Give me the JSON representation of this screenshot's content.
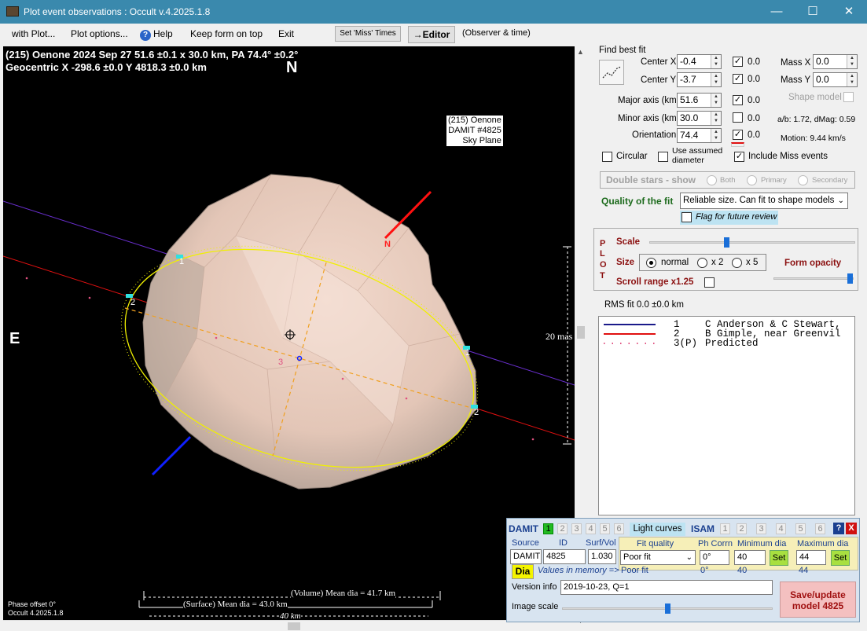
{
  "window": {
    "title": "Plot event observations : Occult v.4.2025.1.8",
    "controls": [
      "—",
      "☐",
      "✕"
    ]
  },
  "menu": {
    "with_plot": "with Plot...",
    "plot_options": "Plot options...",
    "help": "Help",
    "keep_on_top": "Keep form on top",
    "exit": "Exit",
    "set_miss": "Set 'Miss' Times",
    "editor": "→Editor",
    "observer": "(Observer & time)"
  },
  "plot": {
    "line1": "(215) Oenone  2024 Sep 27   51.6 ±0.1 x 30.0 km,  PA 74.4° ±0.2°",
    "line2": "Geocentric  X  -298.6 ±0.0  Y 4818.3 ±0.0 km",
    "north": "N",
    "east": "E",
    "info": [
      "(215) Oenone",
      "DAMIT #4825",
      "Sky Plane"
    ],
    "scale_mas": "20 mas",
    "phase": "Phase offset 0°",
    "version": "Occult 4.2025.1.8",
    "vol_dia": "(Volume) Mean dia = 41.7 km",
    "surf_dia": "(Surface) Mean dia = 43.0 km",
    "km40": "40 km",
    "n_label": "N",
    "chord1": "1",
    "chord2": "2",
    "chord3": "3",
    "colors": {
      "chord1": "#6a2fd0",
      "chord2": "#e01010",
      "ellipse": "#f0f000",
      "axis": "#f0a020"
    }
  },
  "fit": {
    "find_best": "Find best fit",
    "cx_label": "Center X",
    "cx": "-0.4",
    "cx_unc": "0.0",
    "cy_label": "Center Y",
    "cy": "-3.7",
    "cy_unc": "0.0",
    "major_label": "Major axis (km)",
    "major": "51.6",
    "major_unc": "0.0",
    "minor_label": "Minor axis (km)",
    "minor": "30.0",
    "minor_unc": "0.0",
    "orient_label": "Orientation",
    "orient": "74.4",
    "orient_unc": "0.0",
    "massx_label": "Mass X",
    "massx": "0.0",
    "massy_label": "Mass Y",
    "massy": "0.0",
    "shape_model": "Shape model",
    "ab": "a/b: 1.72, dMag: 0.59",
    "motion": "Motion: 9.44 km/s",
    "circular": "Circular",
    "use_assumed": "Use assumed",
    "diameter": "diameter",
    "include_miss": "Include Miss events",
    "double_stars": "Double stars - show",
    "both": "Both",
    "primary": "Primary",
    "secondary": "Secondary",
    "quality_label": "Quality of the fit",
    "quality_value": "Reliable size. Can fit to shape models",
    "flag_review": "Flag for future review"
  },
  "plotctl": {
    "plot_letters": [
      "P",
      "L",
      "O",
      "T"
    ],
    "scale": "Scale",
    "size": "Size",
    "normal": "normal",
    "x2": "x 2",
    "x5": "x 5",
    "form_opacity": "Form opacity",
    "scroll_range": "Scroll range x1.25",
    "scale_level": 0.37,
    "opacity_level": 1.0
  },
  "rms": "RMS fit 0.0 ±0.0 km",
  "observers": [
    {
      "num": "1",
      "name": "C Anderson & C Stewart,",
      "color": "#1a1a8a",
      "style": "solid"
    },
    {
      "num": "2",
      "name": "B Gimple, near Greenvil",
      "color": "#e01010",
      "style": "solid"
    },
    {
      "num": "3(P)",
      "name": "Predicted",
      "color": "#e05080",
      "style": "dotted"
    }
  ],
  "damit": {
    "title": "DAMIT",
    "nums": [
      "1",
      "2",
      "3",
      "4",
      "5",
      "6"
    ],
    "light_curves": "Light curves",
    "isam": "ISAM",
    "help": "?",
    "close": "X",
    "source_lbl": "Source",
    "id_lbl": "ID",
    "sv_lbl": "Surf/Vol",
    "source": "DAMIT",
    "id": "4825",
    "sv": "1.030",
    "fitq_lbl": "Fit quality",
    "phcorr_lbl": "Ph Corrn",
    "mindia_lbl": "Minimum dia",
    "maxdia_lbl": "Maximum dia",
    "fitq": "Poor fit",
    "phcorr": "0°",
    "mindia": "40",
    "maxdia": "44",
    "set": "Set",
    "dia_btn": "Dia",
    "values_mem": "Values in memory =>",
    "mem_fitq": "Poor fit",
    "mem_ph": "0°",
    "mem_min": "40",
    "mem_max": "44",
    "version_lbl": "Version info",
    "version": "2019-10-23, Q=1",
    "image_scale": "Image scale",
    "save1": "Save/update",
    "save2": "model 4825",
    "image_scale_level": 0.5
  }
}
